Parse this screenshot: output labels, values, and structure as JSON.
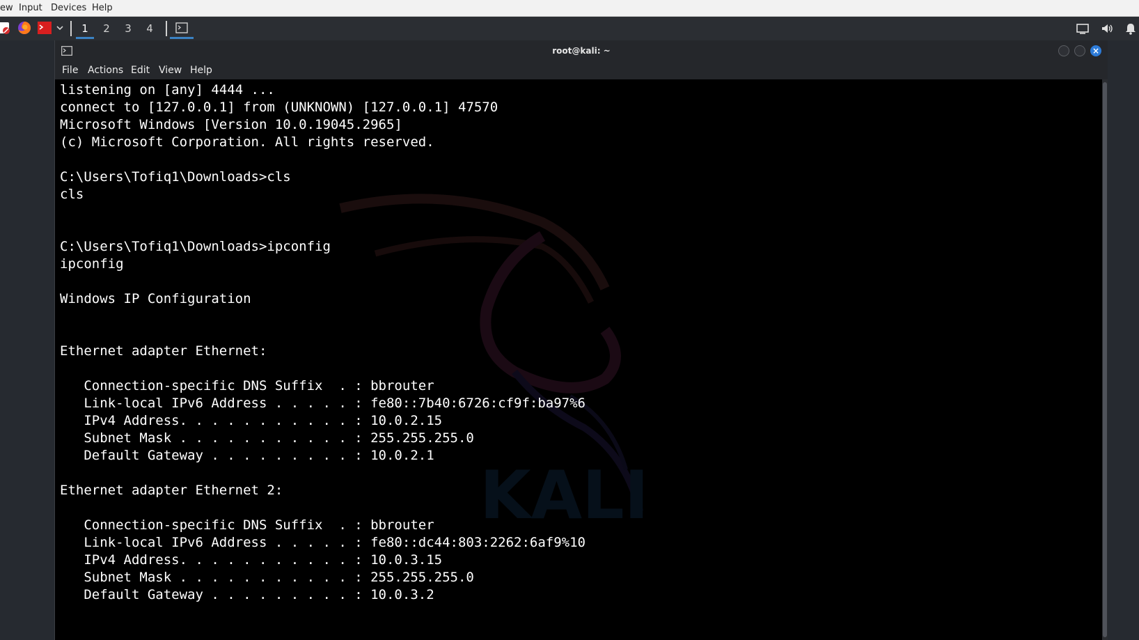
{
  "host_menu": {
    "items": [
      "ew",
      "Input",
      "Devices",
      "Help"
    ]
  },
  "panel": {
    "workspaces": [
      "1",
      "2",
      "3",
      "4"
    ],
    "active_workspace": "1",
    "accent": "#3b82c4"
  },
  "window": {
    "title": "root@kali: ~",
    "menu": [
      "File",
      "Actions",
      "Edit",
      "View",
      "Help"
    ]
  },
  "terminal": {
    "watermark_text": "KALI",
    "lines": [
      "listening on [any] 4444 ...",
      "connect to [127.0.0.1] from (UNKNOWN) [127.0.0.1] 47570",
      "Microsoft Windows [Version 10.0.19045.2965]",
      "(c) Microsoft Corporation. All rights reserved.",
      "",
      "C:\\Users\\Tofiq1\\Downloads>cls",
      "cls",
      "",
      "",
      "C:\\Users\\Tofiq1\\Downloads>ipconfig",
      "ipconfig",
      "",
      "Windows IP Configuration",
      "",
      "",
      "Ethernet adapter Ethernet:",
      "",
      "   Connection-specific DNS Suffix  . : bbrouter",
      "   Link-local IPv6 Address . . . . . : fe80::7b40:6726:cf9f:ba97%6",
      "   IPv4 Address. . . . . . . . . . . : 10.0.2.15",
      "   Subnet Mask . . . . . . . . . . . : 255.255.255.0",
      "   Default Gateway . . . . . . . . . : 10.0.2.1",
      "",
      "Ethernet adapter Ethernet 2:",
      "",
      "   Connection-specific DNS Suffix  . : bbrouter",
      "   Link-local IPv6 Address . . . . . : fe80::dc44:803:2262:6af9%10",
      "   IPv4 Address. . . . . . . . . . . : 10.0.3.15",
      "   Subnet Mask . . . . . . . . . . . : 255.255.255.0",
      "   Default Gateway . . . . . . . . . : 10.0.3.2"
    ]
  }
}
